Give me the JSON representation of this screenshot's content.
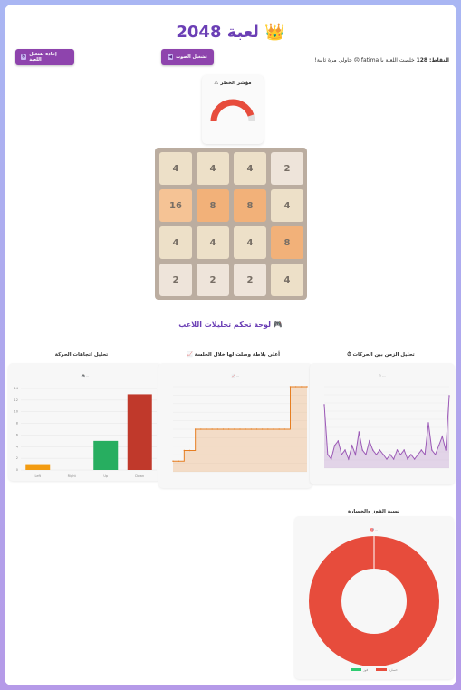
{
  "game": {
    "title": "لعبة 2048 👑",
    "restart_button": "إعادة تشغيل اللعبة",
    "restart_icon": "↻",
    "sound_button": "تشغيل الصوت",
    "sound_icon": "◀",
    "score_label": "النقاط:",
    "score_value": "128",
    "message": "خلصت اللعبة يا fatima 😞 حاولي مرة ثانية!"
  },
  "danger_meter": {
    "label": "⚠ مؤشر الخطر",
    "level": 0.9,
    "color": "#e74c3c"
  },
  "board": [
    [
      4,
      4,
      4,
      2
    ],
    [
      16,
      8,
      8,
      4
    ],
    [
      4,
      4,
      4,
      8
    ],
    [
      2,
      2,
      2,
      4
    ]
  ],
  "tile_colors": {
    "2": "#eee4da",
    "4": "#ede0c8",
    "8": "#f2b179",
    "16": "#f5c395"
  },
  "analytics_title": "لوحة تحكم تحليلات اللاعب 🎮",
  "charts": {
    "moves": {
      "heading": "تحليل اتجاهات الحركة",
      "legend": "🎮 ...",
      "chart_data": {
        "type": "bar",
        "categories": [
          "Left",
          "Right",
          "Up",
          "Down"
        ],
        "values": [
          1,
          0,
          5,
          13
        ],
        "colors": [
          "#f39c12",
          "#2ecc71",
          "#27ae60",
          "#c0392b"
        ],
        "ylim": [
          0,
          14
        ],
        "yticks": [
          0,
          2,
          4,
          6,
          8,
          10,
          12,
          14
        ]
      }
    },
    "max_tile": {
      "heading": "📈 أعلى بلاطة وصلت لها خلال الجلسة",
      "legend": "📈 ...",
      "chart_data": {
        "type": "area",
        "values": [
          2,
          2,
          4,
          4,
          8,
          8,
          8,
          8,
          8,
          8,
          8,
          8,
          8,
          8,
          8,
          8,
          8,
          8,
          8,
          8,
          8,
          16,
          16,
          16,
          16
        ],
        "color": "#e67e22",
        "ylim": [
          0,
          16
        ]
      }
    },
    "time": {
      "heading": "⏱ تحليل الزمن بين الحركات",
      "legend": "⏱ ...",
      "chart_data": {
        "type": "area",
        "values": [
          14,
          3,
          2,
          5,
          6,
          3,
          4,
          2,
          5,
          3,
          8,
          4,
          3,
          6,
          4,
          3,
          4,
          3,
          2,
          3,
          2,
          4,
          3,
          4,
          2,
          3,
          2,
          3,
          4,
          3,
          10,
          4,
          3,
          5,
          7,
          4,
          16
        ],
        "color": "#9b59b6",
        "ylim": [
          0,
          18
        ]
      }
    },
    "winloss": {
      "heading": "نسبة الفوز والخسارة",
      "legend": "🎯 ...",
      "chart_data": {
        "type": "pie",
        "categories": [
          "فوز",
          "خسارة"
        ],
        "values": [
          0,
          1
        ],
        "colors": [
          "#2ecc71",
          "#e74c3c"
        ]
      }
    }
  }
}
